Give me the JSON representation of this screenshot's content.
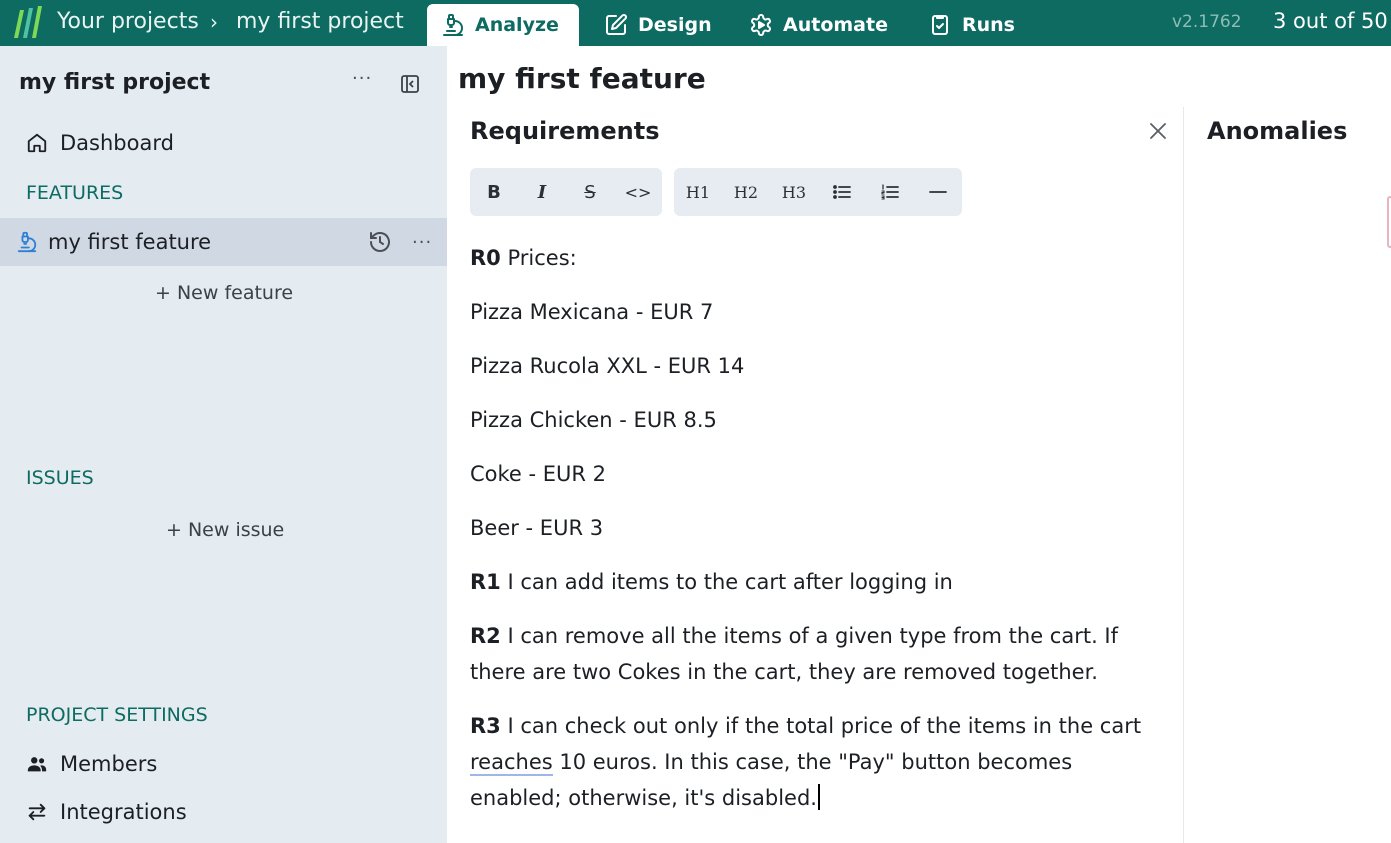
{
  "topbar": {
    "breadcrumb_projects": "Your projects",
    "breadcrumb_separator": "›",
    "breadcrumb_project": "my first project",
    "tabs": [
      {
        "label": "Analyze",
        "icon": "microscope-icon",
        "active": true
      },
      {
        "label": "Design",
        "icon": "pencil-square-icon",
        "active": false
      },
      {
        "label": "Automate",
        "icon": "gear-play-icon",
        "active": false
      },
      {
        "label": "Runs",
        "icon": "clipboard-check-icon",
        "active": false
      }
    ],
    "version": "v2.1762",
    "quota": "3 out of 50"
  },
  "sidebar": {
    "project_title": "my first project",
    "more": "···",
    "dashboard_label": "Dashboard",
    "features_heading": "FEATURES",
    "feature_item": "my first feature",
    "feature_more": "···",
    "new_feature": "+ New feature",
    "issues_heading": "ISSUES",
    "new_issue": "+ New issue",
    "settings_heading": "PROJECT SETTINGS",
    "members_label": "Members",
    "integrations_label": "Integrations"
  },
  "main": {
    "title": "my first feature",
    "panel_title": "Requirements",
    "anomalies_title": "Anomalies",
    "toolbar": {
      "bold": "B",
      "italic": "I",
      "strike": "S",
      "code": "<>",
      "h1": "H1",
      "h2": "H2",
      "h3": "H3"
    },
    "requirements": {
      "r0_tag": "R0",
      "r0_text": " Prices:",
      "prices": [
        "Pizza Mexicana - EUR 7",
        "Pizza Rucola XXL - EUR 14",
        "Pizza Chicken - EUR 8.5",
        "Coke - EUR 2",
        "Beer - EUR 3"
      ],
      "r1_tag": "R1",
      "r1_text": " I can add items to the cart after logging in",
      "r2_tag": "R2",
      "r2_text": " I can remove all the items of a given type from the cart. If there are two Cokes in the cart, they are removed together.",
      "r3_tag": "R3",
      "r3_text_a": " I can check out only if the total price of the items in the cart ",
      "r3_underlined": "reaches",
      "r3_text_b": " 10 euros. In this case, the \"Pay\" button becomes enabled; otherwise, it's disabled."
    }
  },
  "colors": {
    "brand_teal": "#0d6b61",
    "sidebar_bg": "#e4ebf1",
    "selected_row": "#d0d9e3"
  }
}
